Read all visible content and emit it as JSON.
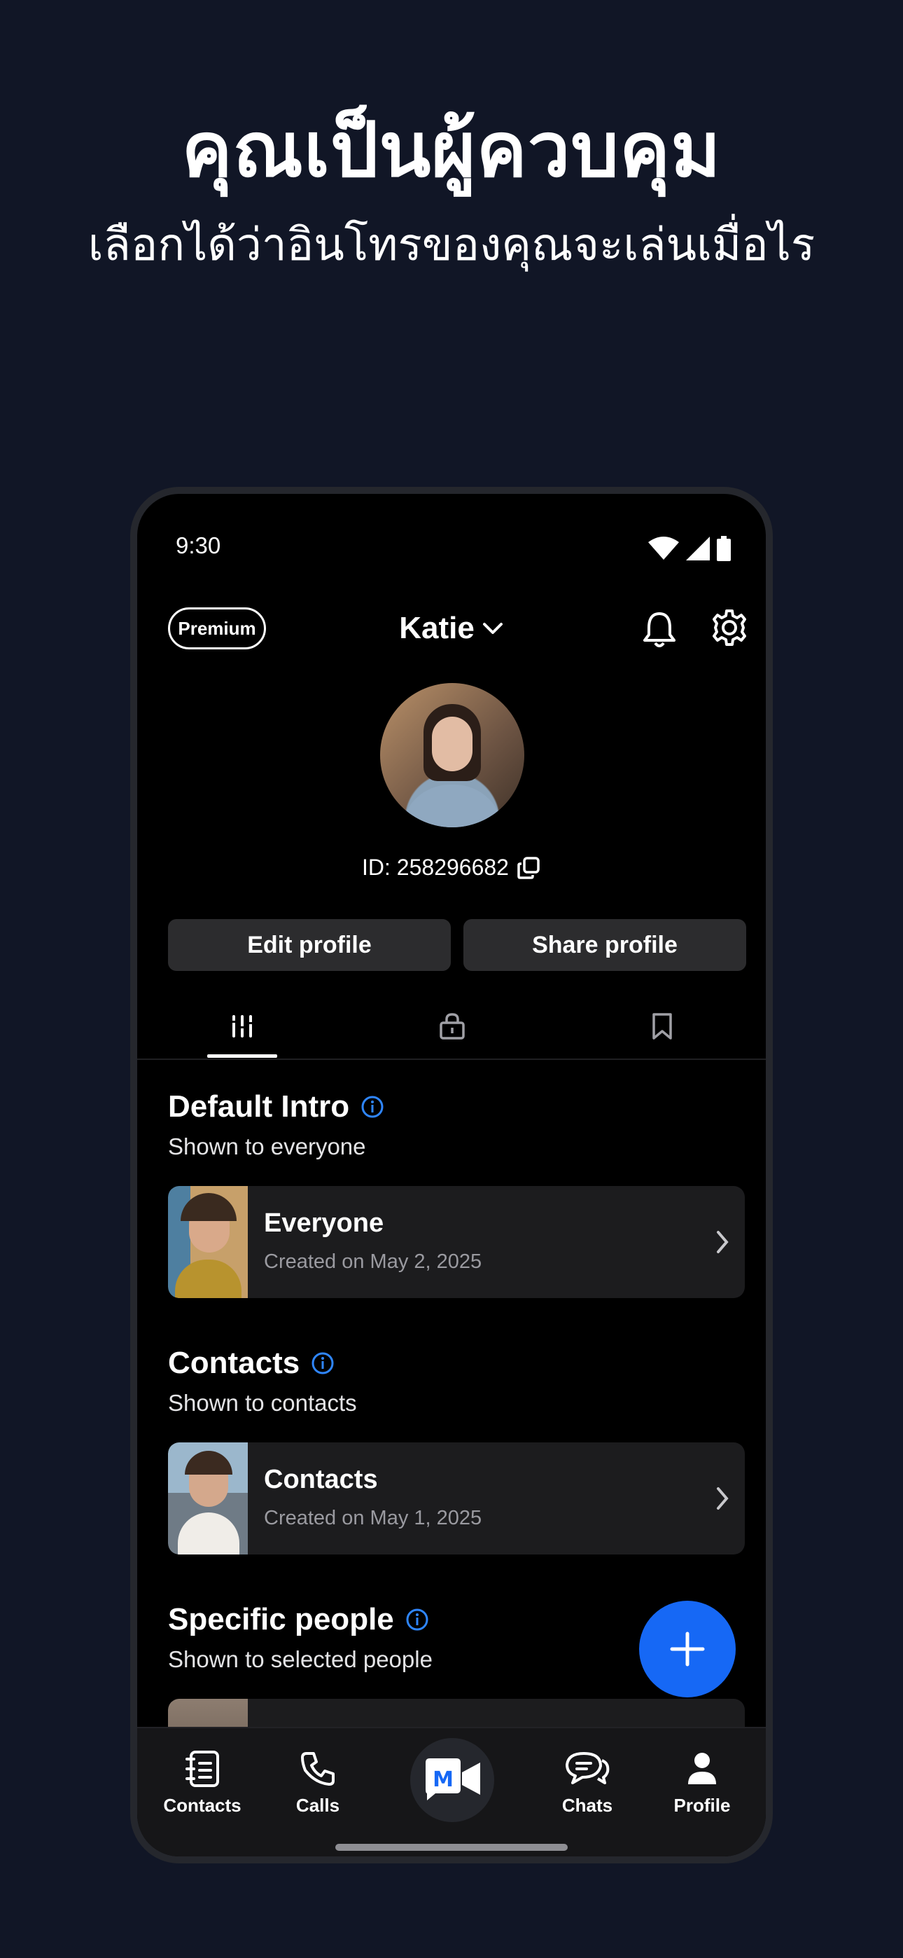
{
  "marketing": {
    "headline": "คุณเป็นผู้ควบคุม",
    "subheadline": "เลือกได้ว่าอินโทรของคุณจะเล่นเมื่อไร"
  },
  "status_bar": {
    "time": "9:30"
  },
  "header": {
    "premium_label": "Premium",
    "username": "Katie"
  },
  "profile": {
    "id_text": "ID: 258296682",
    "edit_label": "Edit profile",
    "share_label": "Share profile"
  },
  "tabs": [
    {
      "icon": "intros-icon",
      "selected": true
    },
    {
      "icon": "lock-icon",
      "selected": false
    },
    {
      "icon": "bookmark-icon",
      "selected": false
    }
  ],
  "sections": [
    {
      "title": "Default Intro",
      "subtitle": "Shown to everyone",
      "card": {
        "title": "Everyone",
        "subtitle": "Created on May 2, 2025"
      }
    },
    {
      "title": "Contacts",
      "subtitle": "Shown to contacts",
      "card": {
        "title": "Contacts",
        "subtitle": "Created on May 1, 2025"
      }
    },
    {
      "title": "Specific people",
      "subtitle": "Shown to selected people"
    }
  ],
  "nav": {
    "contacts": "Contacts",
    "calls": "Calls",
    "chats": "Chats",
    "profile": "Profile"
  },
  "colors": {
    "accent": "#1668f5",
    "background": "#111626",
    "info": "#2f86ff"
  }
}
